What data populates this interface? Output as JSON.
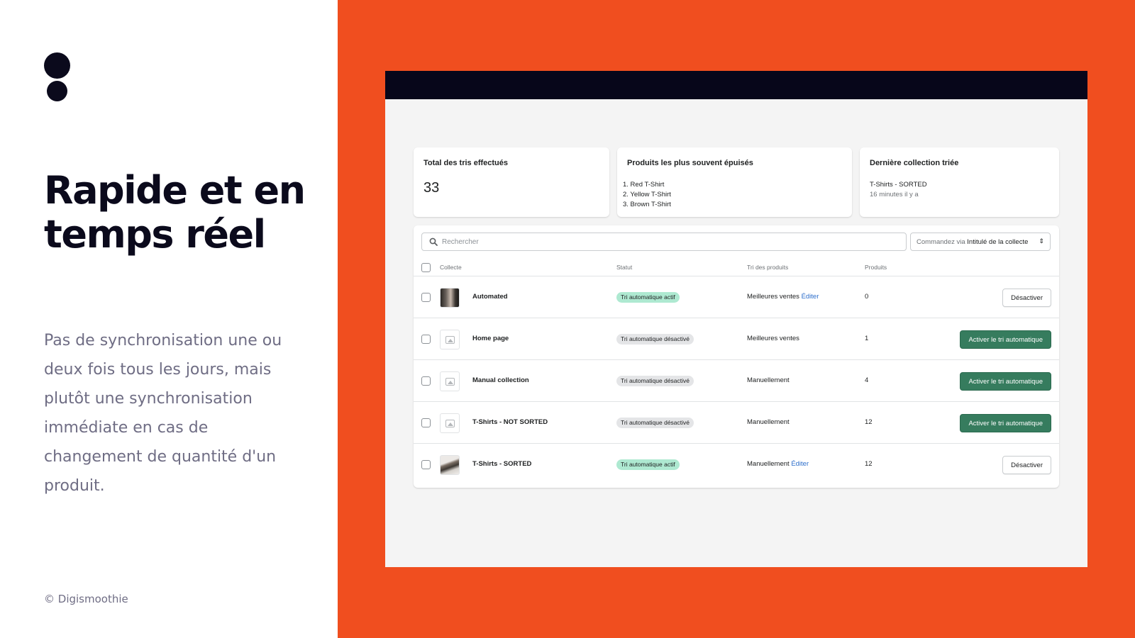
{
  "slide": {
    "headline": "Rapide et en temps réel",
    "body": "Pas de synchronisation une ou deux fois tous les jours, mais plutôt une synchronisation immédiate en cas de changement de quantité d'un produit.",
    "copyright": "© Digismoothie",
    "accent_color": "#f04e1f"
  },
  "stats": {
    "total": {
      "title": "Total des tris effectués",
      "value": "33"
    },
    "sold_out": {
      "title": "Produits les plus souvent épuisés",
      "items": [
        "1. Red T-Shirt",
        "2. Yellow T-Shirt",
        "3. Brown T-Shirt"
      ]
    },
    "last": {
      "title": "Dernière collection triée",
      "name": "T-Shirts - SORTED",
      "time": "16 minutes il y a"
    }
  },
  "toolbar": {
    "search_placeholder": "Rechercher",
    "sort_prefix": "Commandez via",
    "sort_value": "Intitulé de la collecte"
  },
  "table": {
    "headers": {
      "collection": "Collecte",
      "status": "Statut",
      "sorting": "Tri des produits",
      "products": "Produits"
    },
    "rows": [
      {
        "name": "Automated",
        "status": "Tri automatique actif",
        "sorting": "Meilleures ventes",
        "edit": "Éditer",
        "count": "0",
        "action": "Désactiver"
      },
      {
        "name": "Home page",
        "status": "Tri automatique désactivé",
        "sorting": "Meilleures ventes",
        "edit": "",
        "count": "1",
        "action": "Activer le tri automatique"
      },
      {
        "name": "Manual collection",
        "status": "Tri automatique désactivé",
        "sorting": "Manuellement",
        "edit": "",
        "count": "4",
        "action": "Activer le tri automatique"
      },
      {
        "name": "T-Shirts - NOT SORTED",
        "status": "Tri automatique désactivé",
        "sorting": "Manuellement",
        "edit": "",
        "count": "12",
        "action": "Activer le tri automatique"
      },
      {
        "name": "T-Shirts - SORTED",
        "status": "Tri automatique actif",
        "sorting": "Manuellement",
        "edit": "Éditer",
        "count": "12",
        "action": "Désactiver"
      }
    ]
  }
}
